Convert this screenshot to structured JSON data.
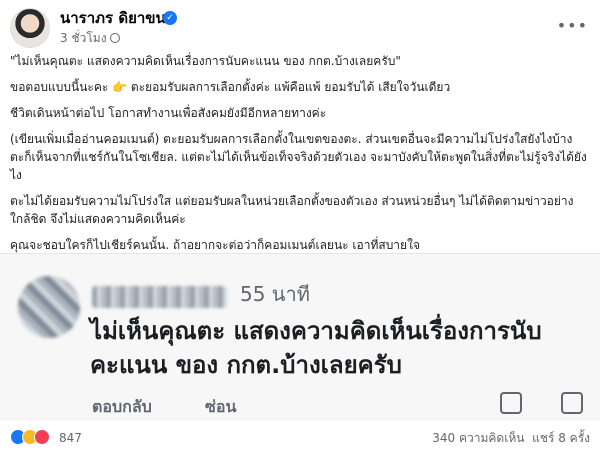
{
  "post": {
    "author": "นาราภร ดิยาขน",
    "verified_icon": "verified-badge-icon",
    "time": "3 ชั่วโมง",
    "paragraphs": [
      "\"ไม่เห็นคุณตะ แสดงความคิดเห็นเรื่องการนับคะแนน ของ กกต.บ้างเลยครับ\"",
      "ขอตอบแบบนี้นะคะ 👉 ตะยอมรับผลการเลือกตั้งค่ะ แพ้คือแพ้ ยอมรับได้ เสียใจวันเดียว",
      "ชีวิตเดินหน้าต่อไป โอกาสทำงานเพื่อสังคมยังมีอีกหลายทางค่ะ",
      "(เขียนเพิ่มเมื่ออ่านคอมเมนต์) ตะยอมรับผลการเลือกตั้งในเขตของตะ. ส่วนเขตอื่นจะมีความไม่โปร่งใสยังไงบ้าง ตะก็เห็นจากที่แชร์กันในโซเชียล. แต่ตะไม่ได้เห็นข้อเท็จจริงด้วยตัวเอง จะมาบังคับให้ตะพูดในสิ่งที่ตะไม่รู้จริงได้ยังไง",
      "ตะไม่ได้ยอมรับความไม่โปร่งใส แต่ยอมรับผลในหน่วยเลือกตั้งของตัวเอง ส่วนหน่วยอื่นๆ ไม่ได้ติดตามข่าวอย่างใกล้ชิด จึงไม่แสดงความคิดเห็นค่ะ",
      "คุณจะชอบใครก็ไปเชียร์คนนั้น. ถ้าอยากจะต่อว่าก็คอมเมนต์เลยนะ เอาที่สบายใจ"
    ]
  },
  "embedded_comment": {
    "time": "55 นาที",
    "text": "ไม่เห็นคุณตะ แสดงความคิดเห็นเรื่องการนับคะแนน ของ กกต.บ้างเลยครับ",
    "reply_label": "ตอบกลับ",
    "hide_label": "ซ่อน"
  },
  "footer": {
    "reaction_count": "847",
    "comments": "340 ความคิดเห็น",
    "shares": "แชร์ 8 ครั้ง"
  },
  "colors": {
    "facebook_blue": "#1877f2",
    "secondary_text": "#65676b"
  }
}
